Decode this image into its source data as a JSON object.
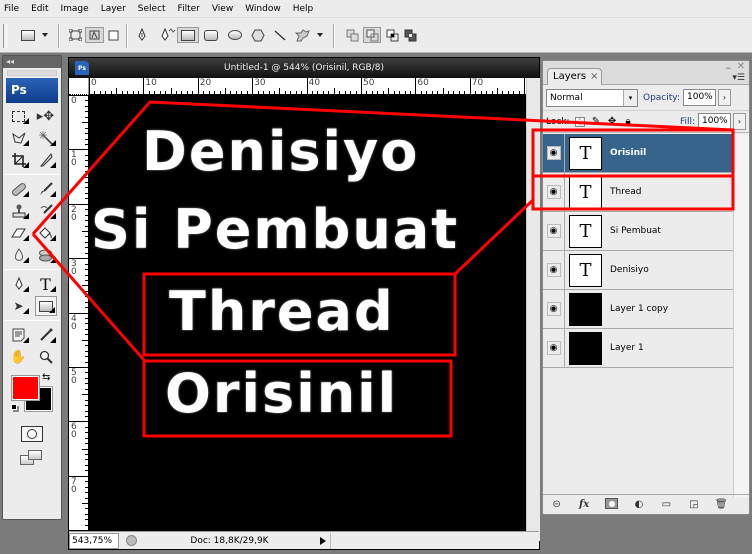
{
  "menu": [
    "File",
    "Edit",
    "Image",
    "Layer",
    "Select",
    "Filter",
    "View",
    "Window",
    "Help"
  ],
  "options_bar": {
    "tools": [
      "shape-layers-mode",
      "paths-mode",
      "fill-pixels-mode",
      "pen-tool",
      "freeform-pen-tool",
      "rectangle-tool",
      "rounded-rectangle-tool",
      "ellipse-tool",
      "polygon-tool",
      "line-tool",
      "custom-shape-tool"
    ],
    "combine_modes": [
      "add",
      "subtract",
      "intersect",
      "exclude"
    ]
  },
  "toolbox": {
    "collapse_label": "◂◂",
    "logo": "Ps",
    "foreground_color": "#ff0000",
    "background_color": "#000000"
  },
  "document": {
    "title": "Untitled-1 @ 544% (Orisinil, RGB/8)",
    "ps_badge": "Ps",
    "ruler_h": [
      "0",
      "10",
      "20",
      "30",
      "40",
      "50",
      "60",
      "70"
    ],
    "ruler_v": [
      "0",
      "10",
      "20",
      "30",
      "40",
      "50",
      "60",
      "70"
    ],
    "canvas_text": [
      "Denisiyo",
      "Si Pembuat",
      "Thread",
      "Orisinil"
    ],
    "zoom": "543,75%",
    "doc_info": "Doc: 18,8K/29,9K"
  },
  "layers_panel": {
    "tab": "Layers",
    "tab_close": "×",
    "blend_mode": "Normal",
    "opacity_label": "Opacity:",
    "opacity": "100%",
    "lock_label": "Lock:",
    "fill_label": "Fill:",
    "fill": "100%",
    "layers": [
      {
        "name": "Orisinil",
        "type": "text",
        "selected": true
      },
      {
        "name": "Thread",
        "type": "text",
        "selected": false
      },
      {
        "name": "Si Pembuat",
        "type": "text",
        "selected": false
      },
      {
        "name": "Denisiyo",
        "type": "text",
        "selected": false
      },
      {
        "name": "Layer 1 copy",
        "type": "pixel",
        "selected": false
      },
      {
        "name": "Layer 1",
        "type": "pixel",
        "selected": false
      }
    ],
    "footer_icons": [
      "link-layers",
      "add-layer-style",
      "add-layer-mask",
      "new-adjustment-layer",
      "new-group",
      "new-layer",
      "delete-layer"
    ]
  },
  "annotation_color": "#ff0000",
  "selection_color": "#36648b"
}
